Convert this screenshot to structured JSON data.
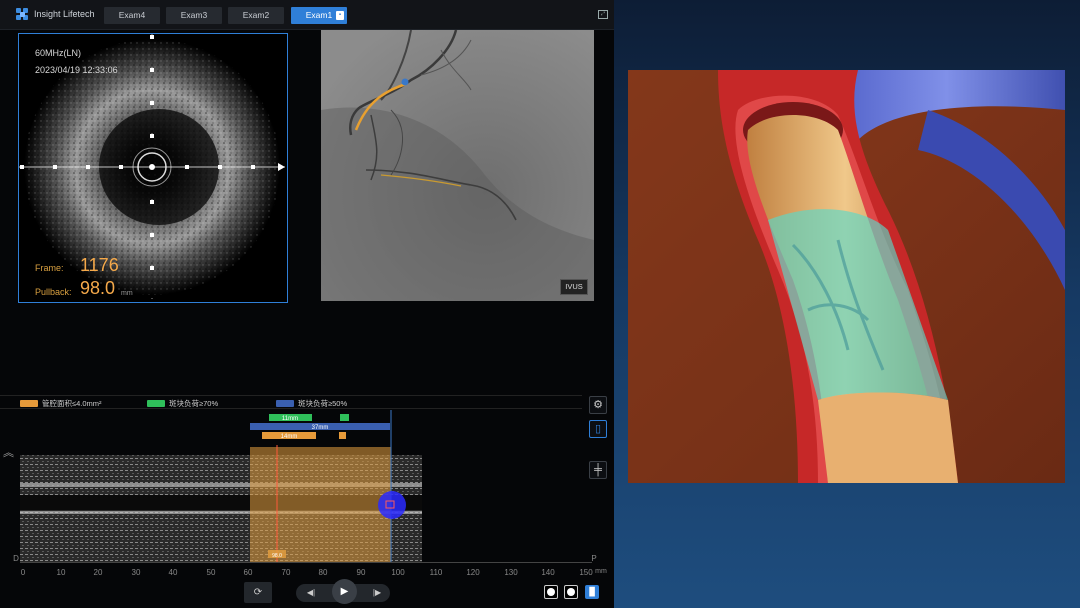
{
  "app": {
    "brand": "Insight Lifetech",
    "tabs": [
      {
        "label": "Exam4",
        "active": false
      },
      {
        "label": "Exam3",
        "active": false
      },
      {
        "label": "Exam2",
        "active": false
      },
      {
        "label": "Exam1",
        "active": true
      }
    ]
  },
  "ivus": {
    "frequency": "60MHz(LN)",
    "datetime": "2023/04/19 12:33:06",
    "frame_label": "Frame:",
    "frame_value": "1176",
    "pullback_label": "Pullback:",
    "pullback_value": "98.0",
    "pullback_unit": "mm"
  },
  "angio": {
    "badge": "IVUS"
  },
  "legend": {
    "items": [
      {
        "label": "管腔面积≤4.0mm²",
        "color": "#e69a3a"
      },
      {
        "label": "斑块负荷≥70%",
        "color": "#2fbf5a"
      },
      {
        "label": "斑块负荷≥50%",
        "color": "#3a5fb0"
      }
    ]
  },
  "segments": {
    "green_label": "11mm",
    "blue_label": "37mm",
    "orange_label": "14mm",
    "marker_label": "98.0"
  },
  "axis": {
    "left_end": "D",
    "right_end": "P",
    "ticks": [
      "0",
      "10",
      "20",
      "30",
      "40",
      "50",
      "60",
      "70",
      "80",
      "90",
      "100",
      "110",
      "120",
      "130",
      "140",
      "150"
    ],
    "unit": "mm"
  },
  "colors": {
    "accent": "#2f7fd8",
    "orange": "#f5a94a",
    "green": "#2fbf5a",
    "blue": "#3a5fb0"
  },
  "icons": {
    "settings": "gear-icon",
    "bookmark": "bookmark-icon",
    "measure": "crosshair-icon",
    "collapse": "double-chevron-up-icon",
    "loop": "loop-icon",
    "prev": "step-back-icon",
    "play": "play-icon",
    "next": "step-forward-icon"
  }
}
